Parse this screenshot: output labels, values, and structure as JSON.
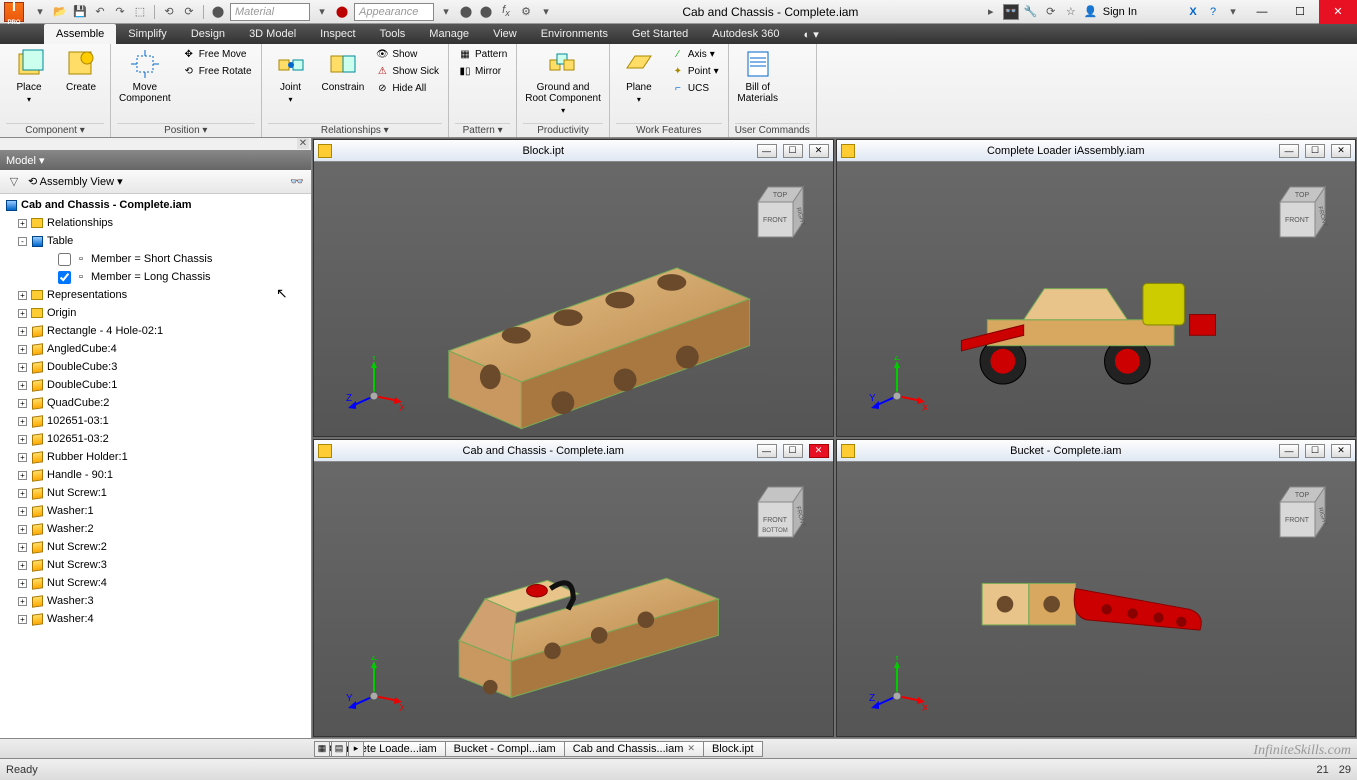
{
  "app": {
    "title": "Cab and Chassis - Complete.iam",
    "pro_badge": "PRO",
    "signin": "Sign In"
  },
  "qat": {
    "material_placeholder": "Material",
    "appearance_placeholder": "Appearance"
  },
  "ribbon": {
    "tabs": [
      "Assemble",
      "Simplify",
      "Design",
      "3D Model",
      "Inspect",
      "Tools",
      "Manage",
      "View",
      "Environments",
      "Get Started",
      "Autodesk 360"
    ],
    "active_tab": 0,
    "groups": {
      "component": {
        "label": "Component ▾",
        "place": "Place",
        "create": "Create"
      },
      "position": {
        "label": "Position ▾",
        "move": "Move\nComponent",
        "free_move": "Free Move",
        "free_rotate": "Free Rotate"
      },
      "relationships": {
        "label": "Relationships ▾",
        "joint": "Joint",
        "constrain": "Constrain",
        "show": "Show",
        "show_sick": "Show Sick",
        "hide_all": "Hide All"
      },
      "pattern": {
        "label": "Pattern ▾",
        "pattern": "Pattern",
        "mirror": "Mirror"
      },
      "productivity": {
        "label": "Productivity",
        "ground": "Ground and\nRoot Component"
      },
      "work": {
        "label": "Work Features",
        "plane": "Plane",
        "axis": "Axis",
        "point": "Point",
        "ucs": "UCS"
      },
      "user": {
        "label": "User Commands",
        "bom": "Bill of\nMaterials"
      }
    }
  },
  "browser": {
    "title": "Model ▾",
    "view": "Assembly View",
    "root": "Cab and Chassis - Complete.iam",
    "nodes": [
      {
        "exp": "+",
        "ico": "folder",
        "label": "Relationships",
        "indent": 1
      },
      {
        "exp": "-",
        "ico": "asm",
        "label": "Table",
        "indent": 1
      },
      {
        "exp": "",
        "ico": "member",
        "label": "Member = Short Chassis",
        "indent": 3,
        "checkbox": false
      },
      {
        "exp": "",
        "ico": "member",
        "label": "Member = Long Chassis",
        "indent": 3,
        "checkbox": true
      },
      {
        "exp": "+",
        "ico": "folder",
        "label": "Representations",
        "indent": 1
      },
      {
        "exp": "+",
        "ico": "folder",
        "label": "Origin",
        "indent": 1
      },
      {
        "exp": "+",
        "ico": "part",
        "label": "Rectangle - 4 Hole-02:1",
        "indent": 1
      },
      {
        "exp": "+",
        "ico": "part",
        "label": "AngledCube:4",
        "indent": 1
      },
      {
        "exp": "+",
        "ico": "part",
        "label": "DoubleCube:3",
        "indent": 1
      },
      {
        "exp": "+",
        "ico": "part",
        "label": "DoubleCube:1",
        "indent": 1
      },
      {
        "exp": "+",
        "ico": "part",
        "label": "QuadCube:2",
        "indent": 1
      },
      {
        "exp": "+",
        "ico": "part",
        "label": "102651-03:1",
        "indent": 1
      },
      {
        "exp": "+",
        "ico": "part",
        "label": "102651-03:2",
        "indent": 1
      },
      {
        "exp": "+",
        "ico": "part",
        "label": "Rubber Holder:1",
        "indent": 1
      },
      {
        "exp": "+",
        "ico": "part",
        "label": "Handle - 90:1",
        "indent": 1
      },
      {
        "exp": "+",
        "ico": "part",
        "label": "Nut Screw:1",
        "indent": 1
      },
      {
        "exp": "+",
        "ico": "part",
        "label": "Washer:1",
        "indent": 1
      },
      {
        "exp": "+",
        "ico": "part",
        "label": "Washer:2",
        "indent": 1
      },
      {
        "exp": "+",
        "ico": "part",
        "label": "Nut Screw:2",
        "indent": 1
      },
      {
        "exp": "+",
        "ico": "part",
        "label": "Nut Screw:3",
        "indent": 1
      },
      {
        "exp": "+",
        "ico": "part",
        "label": "Nut Screw:4",
        "indent": 1
      },
      {
        "exp": "+",
        "ico": "part",
        "label": "Washer:3",
        "indent": 1
      },
      {
        "exp": "+",
        "ico": "part",
        "label": "Washer:4",
        "indent": 1
      }
    ]
  },
  "viewports": [
    {
      "title": "Block.ipt",
      "close_active": false,
      "axes": {
        "up": "Y",
        "right": "X",
        "out": "Z"
      },
      "cube": {
        "top": "TOP",
        "front": "FRONT",
        "right": "RIGHT"
      }
    },
    {
      "title": "Complete Loader iAssembly.iam",
      "close_active": false,
      "axes": {
        "up": "Z",
        "right": "X",
        "out": "Y"
      },
      "cube": {
        "top": "TOP",
        "left": "LEFT",
        "front": "FRONT"
      }
    },
    {
      "title": "Cab and Chassis - Complete.iam",
      "close_active": true,
      "axes": {
        "up": "Z",
        "right": "X",
        "out": "Y"
      },
      "cube": {
        "front": "FRONT",
        "bottom": "BOTTOM",
        "left": "LEFT"
      }
    },
    {
      "title": "Bucket - Complete.iam",
      "close_active": false,
      "axes": {
        "up": "Y",
        "right": "X",
        "out": "Z"
      },
      "cube": {
        "top": "TOP",
        "front": "FRONT",
        "right": "RIGHT"
      }
    }
  ],
  "doc_tabs": [
    {
      "label": "Complete Loade...iam",
      "closable": false
    },
    {
      "label": "Bucket - Compl...iam",
      "closable": false
    },
    {
      "label": "Cab and Chassis...iam",
      "closable": true
    },
    {
      "label": "Block.ipt",
      "closable": false
    }
  ],
  "status": {
    "left": "Ready",
    "n1": "21",
    "n2": "29",
    "watermark": "InfiniteSkills.com"
  }
}
